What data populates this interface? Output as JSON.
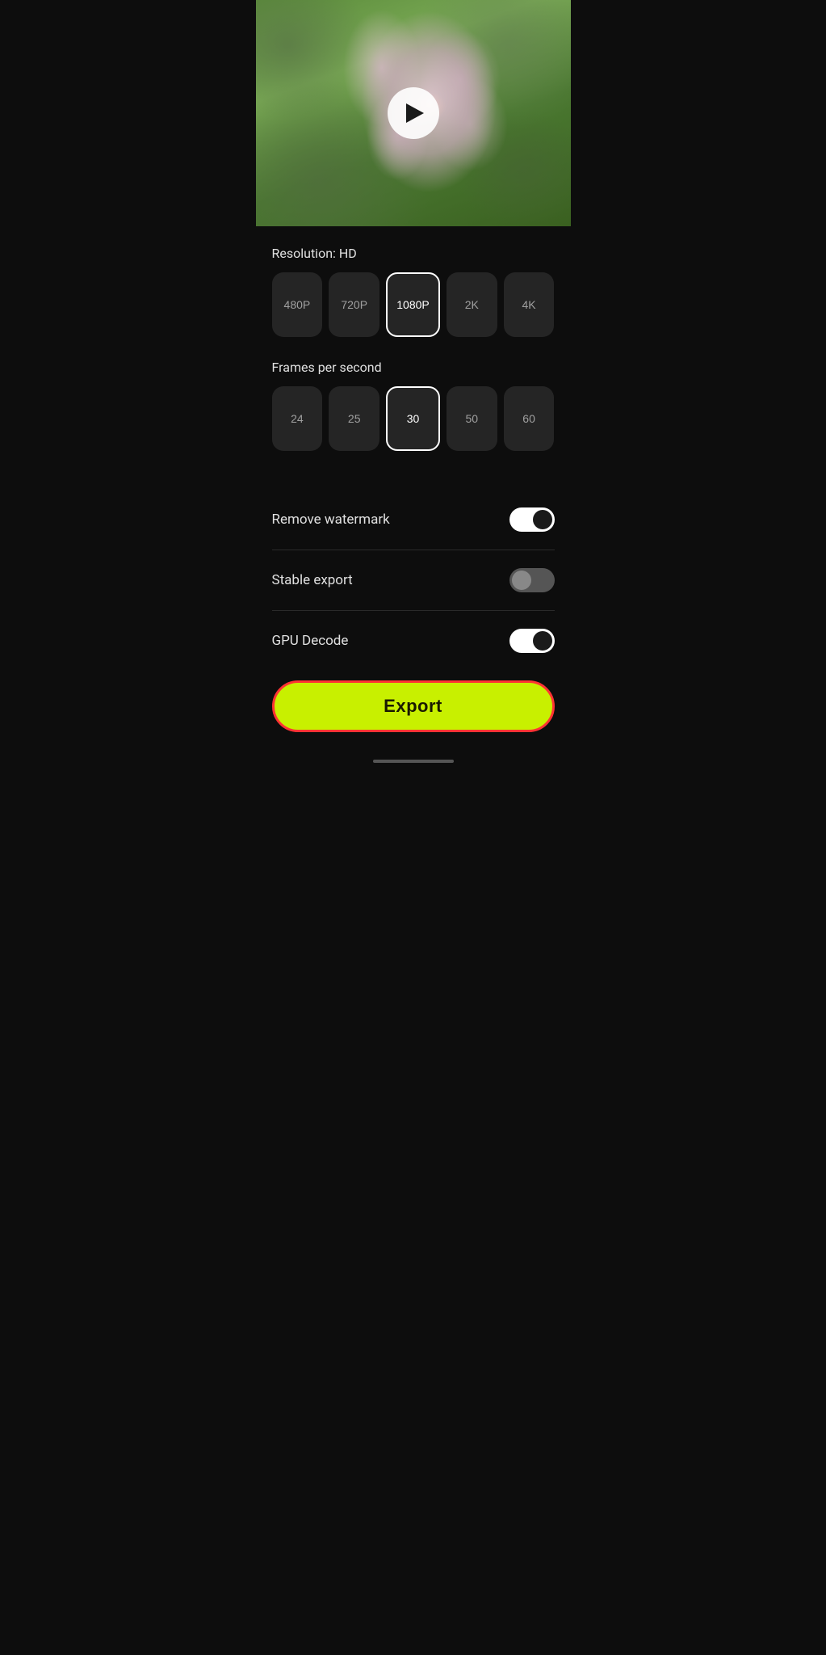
{
  "video": {
    "hasPlayButton": true
  },
  "resolution": {
    "label": "Resolution: HD",
    "options": [
      "480P",
      "720P",
      "1080P",
      "2K",
      "4K"
    ],
    "selected": "1080P"
  },
  "fps": {
    "label": "Frames per second",
    "options": [
      "24",
      "25",
      "30",
      "50",
      "60"
    ],
    "selected": "30"
  },
  "toggles": [
    {
      "id": "remove-watermark",
      "label": "Remove watermark",
      "state": "on"
    },
    {
      "id": "stable-export",
      "label": "Stable export",
      "state": "off"
    },
    {
      "id": "gpu-decode",
      "label": "GPU Decode",
      "state": "on"
    }
  ],
  "export": {
    "button_label": "Export"
  }
}
